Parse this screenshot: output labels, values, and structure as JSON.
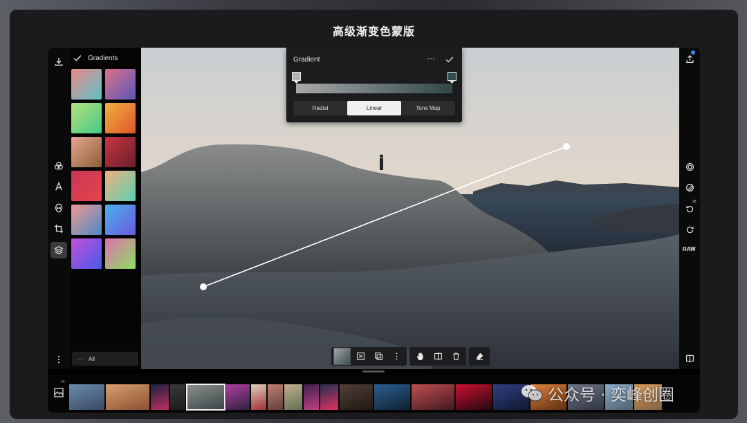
{
  "slide": {
    "title": "高级渐变色蒙版"
  },
  "left_toolbar": {
    "items": [
      {
        "name": "download-icon"
      },
      {
        "name": "blend-icon"
      },
      {
        "name": "text-icon"
      },
      {
        "name": "face-icon"
      },
      {
        "name": "crop-icon"
      },
      {
        "name": "layers-icon",
        "active": true
      },
      {
        "name": "more-vertical-icon"
      }
    ]
  },
  "gradients_panel": {
    "title": "Gradients",
    "all_label": "All",
    "all_dots": "···",
    "swatches": [
      {
        "from": "#e88a8a",
        "to": "#5fc0c8"
      },
      {
        "from": "#d9728a",
        "to": "#5b57b8"
      },
      {
        "from": "#b5e07a",
        "to": "#45c98a"
      },
      {
        "from": "#f0b040",
        "to": "#e0552a"
      },
      {
        "from": "#e8a590",
        "to": "#8a6035"
      },
      {
        "from": "#c73540",
        "to": "#6a1e2c"
      },
      {
        "from": "#c8355a",
        "to": "#e8454a"
      },
      {
        "from": "#f0b080",
        "to": "#5ad0b0"
      },
      {
        "from": "#f09890",
        "to": "#4a8ac8"
      },
      {
        "from": "#4ab0e8",
        "to": "#6a5ae0"
      },
      {
        "from": "#c050d8",
        "to": "#4a5ae8"
      },
      {
        "from": "#e070b0",
        "to": "#8ae060"
      }
    ]
  },
  "gradient_dialog": {
    "title": "Gradient",
    "dots": "···",
    "stop_left_color": "#b0b0b0",
    "stop_right_color": "#2f4f4f",
    "tabs": [
      {
        "label": "Radial",
        "active": false
      },
      {
        "label": "Linear",
        "active": true
      },
      {
        "label": "Tone Map",
        "active": false
      }
    ]
  },
  "right_toolbar": {
    "raw_label": "RAW",
    "history_count": "28",
    "items": [
      "share-icon",
      "spiral-icon",
      "slash-circle-icon",
      "history-icon",
      "undo-icon",
      "compare-icon"
    ]
  },
  "mask_toolbar": {
    "groups": [
      [
        "mask-thumbnail",
        "fit-icon",
        "duplicate-icon",
        "more-icon"
      ],
      [
        "hand-icon",
        "split-icon",
        "trash-icon"
      ],
      [
        "eraser-icon"
      ]
    ]
  },
  "filmstrip": {
    "count": "44",
    "thumbs": [
      {
        "c1": "#6a8ab0",
        "c2": "#3a4a60",
        "w": 51
      },
      {
        "c1": "#d8a070",
        "c2": "#8a5030",
        "w": 63
      },
      {
        "c1": "#1a2040",
        "c2": "#c03060",
        "w": 26
      },
      {
        "c1": "#3a3a3a",
        "c2": "#1a1a1a",
        "w": 22
      },
      {
        "c1": "#8a9090",
        "c2": "#3a4444",
        "w": 55,
        "selected": true
      },
      {
        "c1": "#b040a0",
        "c2": "#302040",
        "w": 34
      },
      {
        "c1": "#e0d0c0",
        "c2": "#a03030",
        "w": 22
      },
      {
        "c1": "#c08070",
        "c2": "#604040",
        "w": 22
      },
      {
        "c1": "#c0b090",
        "c2": "#607050",
        "w": 26
      },
      {
        "c1": "#402050",
        "c2": "#c04080",
        "w": 22
      },
      {
        "c1": "#203050",
        "c2": "#e03060",
        "w": 26
      },
      {
        "c1": "#504038",
        "c2": "#201810",
        "w": 48
      },
      {
        "c1": "#2a6090",
        "c2": "#102030",
        "w": 52
      },
      {
        "c1": "#c05050",
        "c2": "#401820",
        "w": 62
      },
      {
        "c1": "#d01030",
        "c2": "#200810",
        "w": 52
      },
      {
        "c1": "#304080",
        "c2": "#101830",
        "w": 52
      },
      {
        "c1": "#e08040",
        "c2": "#603010",
        "w": 52
      },
      {
        "c1": "#707888",
        "c2": "#303440",
        "w": 52
      },
      {
        "c1": "#90b0d0",
        "c2": "#506070",
        "w": 40
      },
      {
        "c1": "#e0a060",
        "c2": "#806040",
        "w": 40
      }
    ]
  },
  "watermark": {
    "text": "公众号 · 奕峰创圈"
  }
}
